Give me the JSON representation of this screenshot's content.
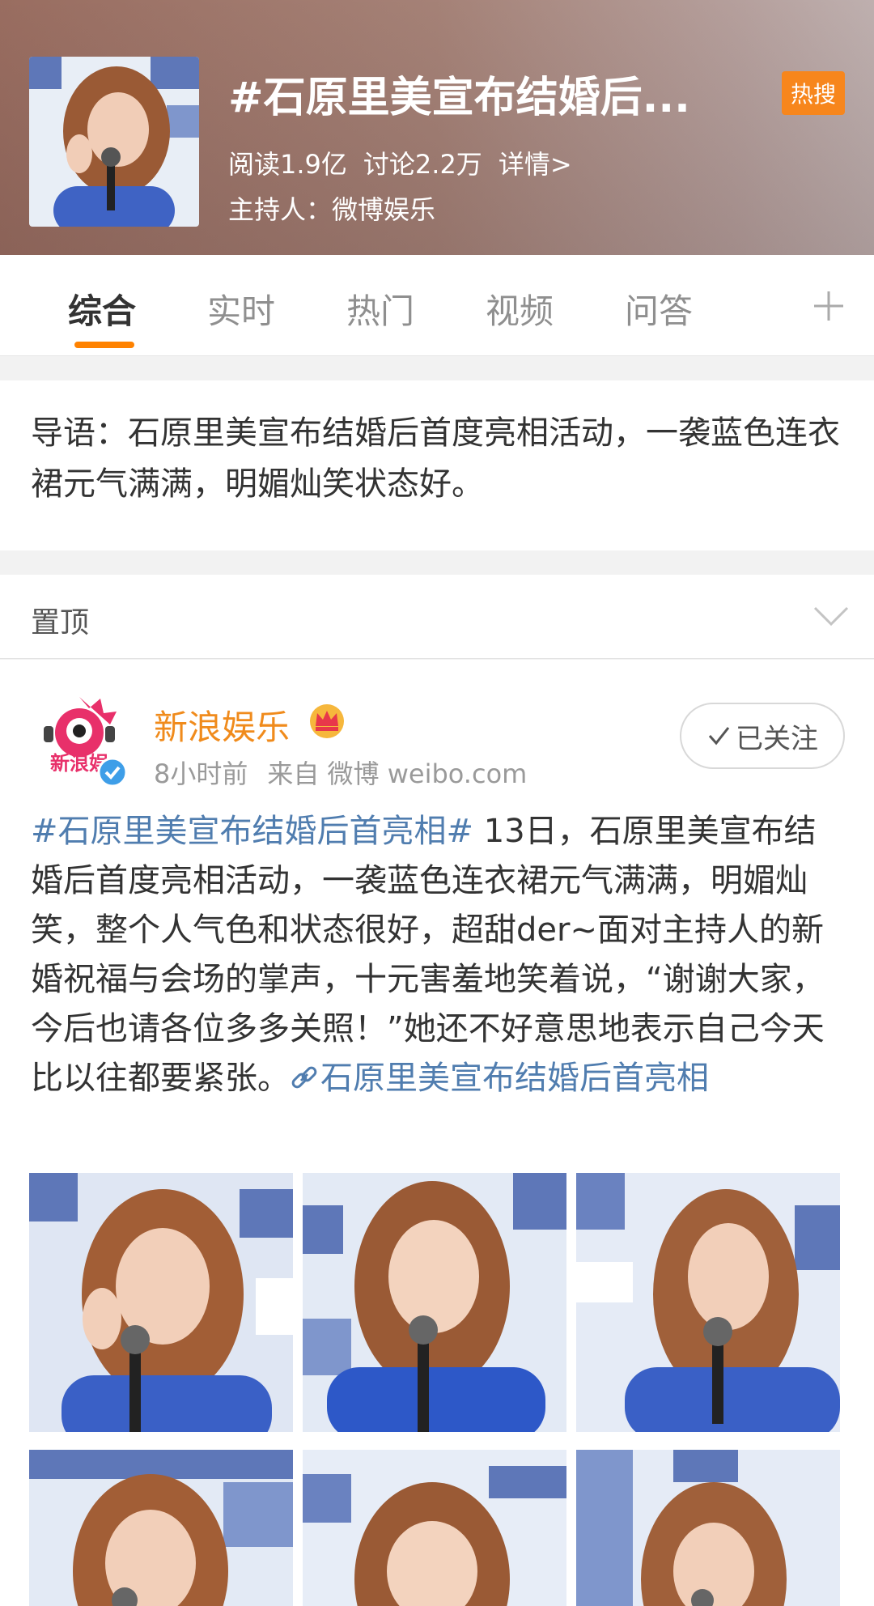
{
  "topic": {
    "title": "#石原里美宣布结婚后...",
    "badge": "热搜",
    "reads": "阅读1.9亿",
    "discussions": "讨论2.2万",
    "details": "详情>",
    "host": "主持人：微博娱乐"
  },
  "tabs": [
    {
      "label": "综合",
      "active": true
    },
    {
      "label": "实时",
      "active": false
    },
    {
      "label": "热门",
      "active": false
    },
    {
      "label": "视频",
      "active": false
    },
    {
      "label": "问答",
      "active": false
    }
  ],
  "intro": {
    "text": "导语：石原里美宣布结婚后首度亮相活动，一袭蓝色连衣裙元气满满，明媚灿笑状态好。"
  },
  "pinned": {
    "label": "置顶"
  },
  "post": {
    "author": "新浪娱乐",
    "avatar_text": "新浪娱",
    "time": "8小时前",
    "source": "来自 微博 weibo.com",
    "follow_label": "已关注",
    "hashtag": "#石原里美宣布结婚后首亮相#",
    "body": " 13日，石原里美宣布结婚后首度亮相活动，一袭蓝色连衣裙元气满满，明媚灿笑，整个人气色和状态很好，超甜der~面对主持人的新婚祝福与会场的掌声，十元害羞地笑着说，“谢谢大家，今后也请各位多多关照！”她还不好意思地表示自己今天比以往都要紧张。",
    "link_text": "石原里美宣布结婚后首亮相"
  },
  "colors": {
    "accent": "#ff8200",
    "author": "#f08b1c",
    "link": "#507daf",
    "badge": "#f7861c"
  },
  "icons": [
    "plus-icon",
    "chevron-down-icon",
    "crown-icon",
    "verified-icon",
    "check-icon",
    "link-icon"
  ]
}
